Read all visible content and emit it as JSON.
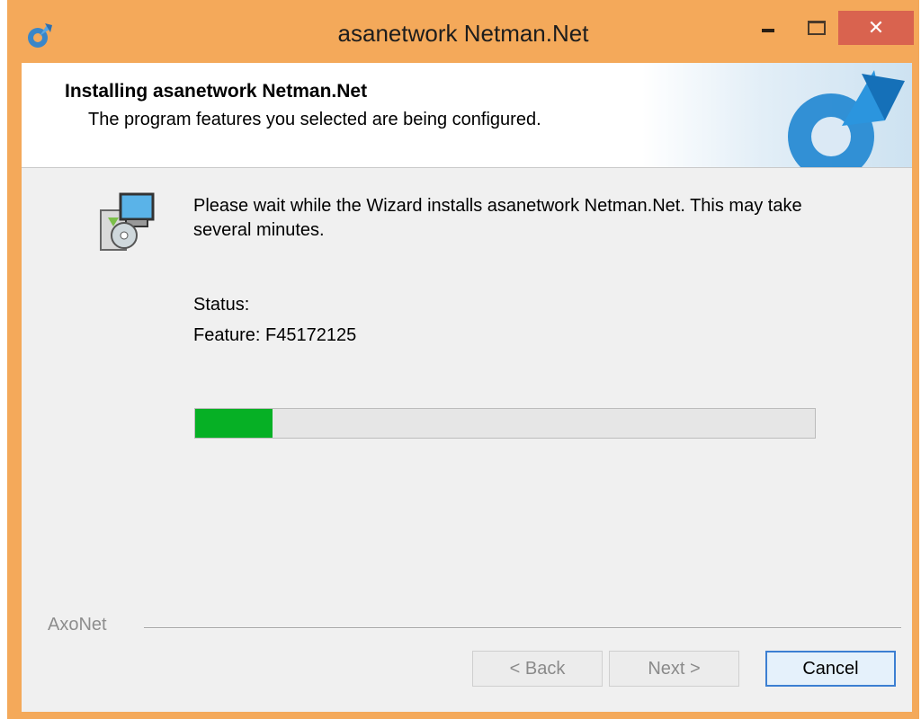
{
  "window": {
    "title": "asanetwork Netman.Net",
    "frame_color": "#f4a95a",
    "close_color": "#d9634f",
    "controls": {
      "minimize_icon": "minimize-icon",
      "maximize_icon": "maximize-icon",
      "close_label": "✕"
    }
  },
  "banner": {
    "title": "Installing asanetwork Netman.Net",
    "subtitle": "The program features you selected are being configured."
  },
  "content": {
    "wait_message": "Please wait while the Wizard installs asanetwork Netman.Net. This may take several minutes.",
    "status_label": "Status:",
    "status_value": "Feature: F45172125",
    "progress_percent": 12.5,
    "progress_color": "#06b025"
  },
  "footer": {
    "brand": "AxoNet",
    "buttons": {
      "back": "< Back",
      "next": "Next >",
      "cancel": "Cancel"
    }
  }
}
